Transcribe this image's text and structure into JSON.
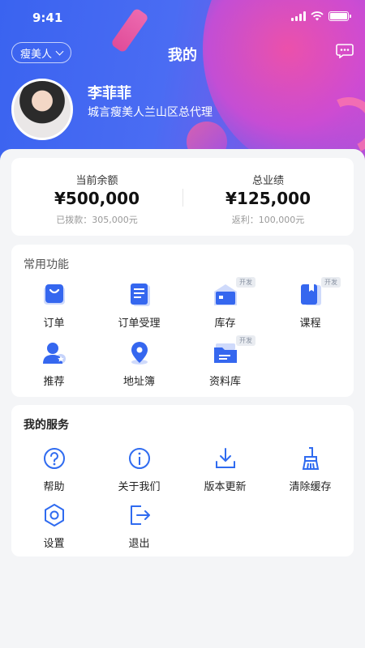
{
  "status_bar": {
    "time": "9:41"
  },
  "nav": {
    "dropdown_label": "瘦美人",
    "title": "我的",
    "message_icon": "chat-bubble-icon"
  },
  "profile": {
    "name": "李菲菲",
    "role": "城言瘦美人兰山区总代理"
  },
  "stats": [
    {
      "label": "当前余额",
      "value": "¥500,000",
      "sub": "已拨款：305,000元"
    },
    {
      "label": "总业绩",
      "value": "¥125,000",
      "sub": "返利：100,000元"
    }
  ],
  "functions": {
    "title": "常用功能",
    "items": [
      {
        "label": "订单",
        "icon": "shopping-bag-icon",
        "badge": ""
      },
      {
        "label": "订单受理",
        "icon": "document-list-icon",
        "badge": ""
      },
      {
        "label": "库存",
        "icon": "warehouse-icon",
        "badge": "开发"
      },
      {
        "label": "课程",
        "icon": "book-icon",
        "badge": "开发"
      },
      {
        "label": "推荐",
        "icon": "user-star-icon",
        "badge": ""
      },
      {
        "label": "地址簿",
        "icon": "location-pin-icon",
        "badge": ""
      },
      {
        "label": "资料库",
        "icon": "folder-icon",
        "badge": "开发"
      }
    ]
  },
  "services": {
    "title": "我的服务",
    "items": [
      {
        "label": "帮助",
        "icon": "help-circle-icon"
      },
      {
        "label": "关于我们",
        "icon": "info-circle-icon"
      },
      {
        "label": "版本更新",
        "icon": "download-icon"
      },
      {
        "label": "清除缓存",
        "icon": "broom-icon"
      },
      {
        "label": "设置",
        "icon": "gear-icon"
      },
      {
        "label": "退出",
        "icon": "logout-icon"
      }
    ]
  },
  "colors": {
    "primary": "#3b63f0",
    "accent_pink": "#f1498f",
    "icon_blue": "#2f6bf0"
  }
}
